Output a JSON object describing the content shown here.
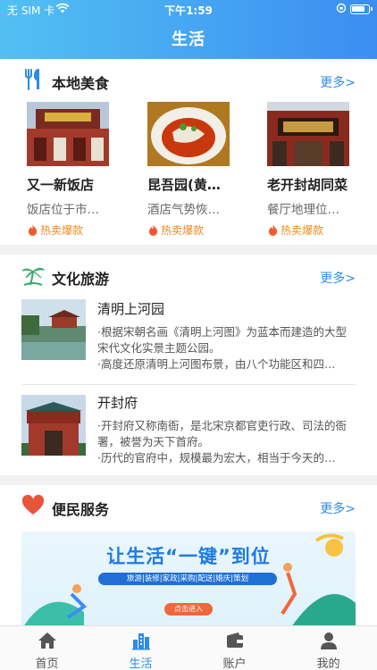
{
  "status": {
    "carrier": "无 SIM 卡",
    "time": "下午1:59"
  },
  "header": {
    "title": "生活"
  },
  "food": {
    "title": "本地美食",
    "more": "更多>",
    "items": [
      {
        "name": "又一新饭店",
        "desc": "饭店位于市…",
        "badge": "热卖爆款"
      },
      {
        "name": "昆吾园(黄…",
        "desc": "酒店气势恢…",
        "badge": "热卖爆款"
      },
      {
        "name": "老开封胡同菜",
        "desc": "餐厅地理位…",
        "badge": "热卖爆款"
      }
    ]
  },
  "tourism": {
    "title": "文化旅游",
    "more": "更多>",
    "items": [
      {
        "name": "清明上河园",
        "line1": "·根据宋朝名画《清明上河图》为蓝本而建造的大型宋代文化实景主题公园。",
        "line2": "·高度还原清明上河图布景，由八个功能区和四…"
      },
      {
        "name": "开封府",
        "line1": "·开封府又称南衙，是北宋京都官吏行政、司法的衙署，被誉为天下首府。",
        "line2": "·历代的官府中，规模最为宏大，相当于今天的…"
      }
    ]
  },
  "service": {
    "title": "便民服务",
    "more": "更多>",
    "banner": {
      "headline": "让生活“一键”到位",
      "tags": "旅游|装修|家政|采购|配送|婚庆|策划",
      "button": "点击进入"
    }
  },
  "tabbar": [
    {
      "label": "首页",
      "icon": "home-icon"
    },
    {
      "label": "生活",
      "icon": "city-icon"
    },
    {
      "label": "账户",
      "icon": "wallet-icon"
    },
    {
      "label": "我的",
      "icon": "user-icon"
    }
  ],
  "colors": {
    "accent": "#2f8be8",
    "hot": "#f08a20",
    "header_start": "#52c0f2",
    "header_end": "#3b8df2"
  }
}
